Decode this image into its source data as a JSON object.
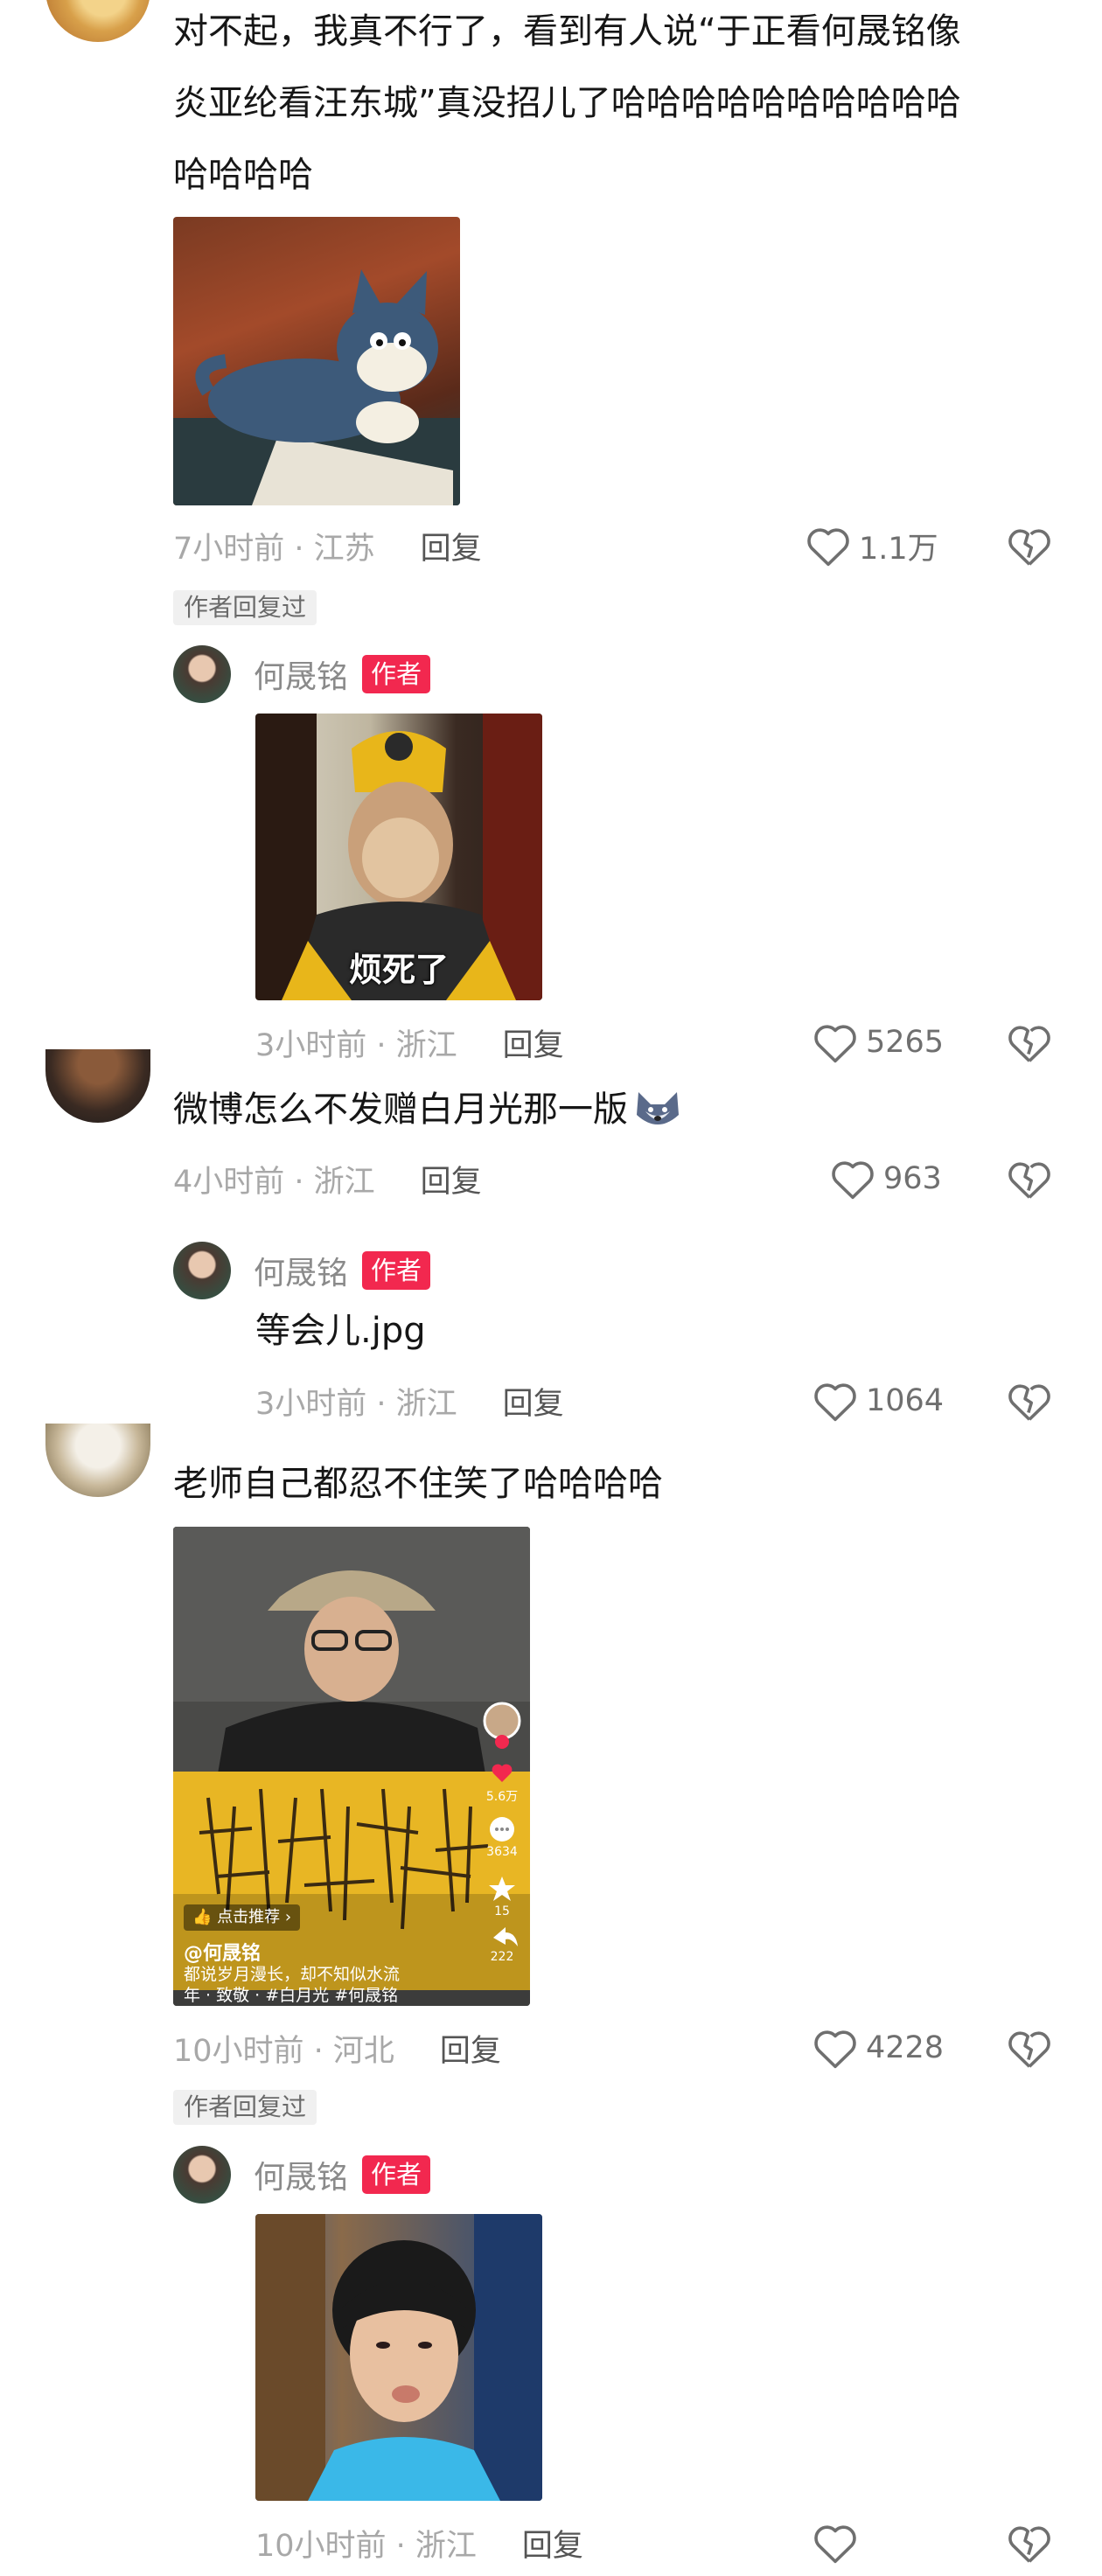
{
  "comments": [
    {
      "text_lines": [
        "对不起，我真不行了，看到有人说“于正看何晟铭像",
        "炎亚纶看汪东城”真没招儿了哈哈哈哈哈哈哈哈哈哈",
        "哈哈哈哈"
      ],
      "time_location": "7小时前 · 江苏",
      "reply_label": "回复",
      "likes": "1.1万",
      "author_replied_badge": "作者回复过",
      "author_reply": {
        "name": "何晟铭",
        "badge": "作者",
        "sticker_caption": "烦死了",
        "time_location": "3小时前 · 浙江",
        "reply_label": "回复",
        "likes": "5265"
      }
    },
    {
      "text": "微博怎么不发赠白月光那一版",
      "emoji": "wolf-emoji",
      "time_location": "4小时前 · 浙江",
      "reply_label": "回复",
      "likes": "963",
      "author_reply": {
        "name": "何晟铭",
        "badge": "作者",
        "text": "等会儿.jpg",
        "time_location": "3小时前 · 浙江",
        "reply_label": "回复",
        "likes": "1064"
      }
    },
    {
      "text": "老师自己都忍不住笑了哈哈哈哈",
      "video_card": {
        "tag": "点击推荐",
        "username": "@何晟铭",
        "desc_line1": "都说岁月漫长，却不知似水流",
        "desc_line2": "年 · 致敬 · #白月光 #何晟铭",
        "likes": "5.6万",
        "comments": "3634",
        "favorites": "15",
        "shares": "222"
      },
      "time_location": "10小时前 · 河北",
      "reply_label": "回复",
      "likes": "4228",
      "author_replied_badge": "作者回复过",
      "author_reply": {
        "name": "何晟铭",
        "badge": "作者",
        "time_location": "10小时前 · 浙江",
        "reply_label": "回复"
      }
    }
  ],
  "colors": {
    "author_badge": "#f2284f",
    "text": "#161616",
    "meta": "#a8a8a8",
    "replied_badge_bg": "#f0f0f0"
  }
}
